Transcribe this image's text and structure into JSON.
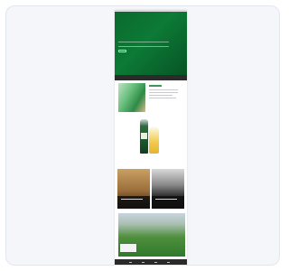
{
  "page": {
    "hero_title": "",
    "footer_links": [
      "",
      "",
      "",
      ""
    ]
  },
  "colors": {
    "brand_green": "#0a6a2e",
    "accent_green": "#3f9456",
    "dark": "#2b2b2b"
  }
}
